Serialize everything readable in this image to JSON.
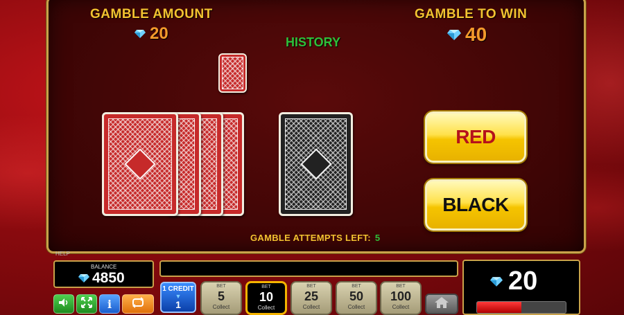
{
  "header": {
    "gamble_amount_label": "GAMBLE AMOUNT",
    "gamble_amount_value": "20",
    "gamble_to_win_label": "GAMBLE TO WIN",
    "gamble_to_win_value": "40",
    "history_label": "HISTORY"
  },
  "cards": {
    "history_cards": [
      {
        "color": "red"
      }
    ],
    "deck_cards": [
      {
        "color": "red"
      },
      {
        "color": "red"
      },
      {
        "color": "red"
      },
      {
        "color": "red"
      }
    ],
    "current_card": {
      "color": "black"
    }
  },
  "choices": {
    "red_label": "RED",
    "black_label": "BLACK"
  },
  "attempts": {
    "label": "GAMBLE ATTEMPTS LEFT:",
    "value": "5"
  },
  "bottom": {
    "help_label": "HELP",
    "balance_label": "BALANCE",
    "balance_value": "4850",
    "credit_label": "1 CREDIT",
    "credit_value": "1",
    "bet_label": "BET",
    "collect_label": "Collect",
    "bets": [
      "5",
      "10",
      "25",
      "50",
      "100"
    ],
    "active_bet": "10",
    "win_value": "20",
    "win_progress": 0.5
  },
  "colors": {
    "accent_gold": "#f2c230",
    "value_orange": "#f39a2b",
    "history_green": "#2fbf3a",
    "button_yellow": "#ffe14a"
  }
}
